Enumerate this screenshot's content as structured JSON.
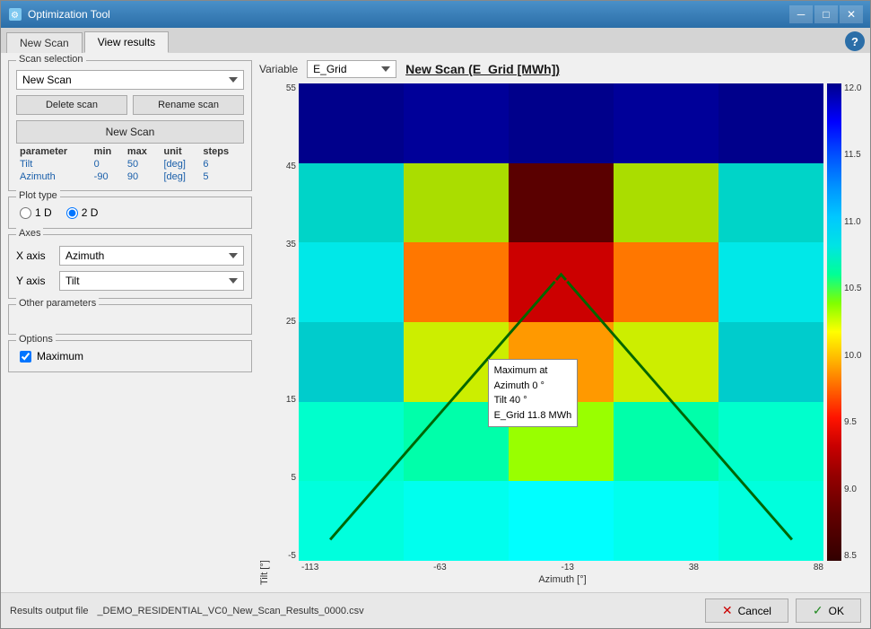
{
  "window": {
    "title": "Optimization Tool",
    "tabs": [
      "New Scan",
      "View results"
    ],
    "active_tab": "View results",
    "help_label": "?"
  },
  "left": {
    "scan_selection_label": "Scan selection",
    "scan_dropdown_value": "New Scan",
    "scan_dropdown_options": [
      "New Scan"
    ],
    "delete_scan_label": "Delete scan",
    "rename_scan_label": "Rename scan",
    "new_scan_label": "New Scan",
    "params_headers": [
      "parameter",
      "min",
      "max",
      "unit",
      "steps"
    ],
    "params_rows": [
      [
        "Tilt",
        "0",
        "50",
        "[deg]",
        "6"
      ],
      [
        "Azimuth",
        "-90",
        "90",
        "[deg]",
        "5"
      ]
    ],
    "plot_type_label": "Plot type",
    "radio_1d": "1 D",
    "radio_2d": "2 D",
    "active_radio": "2D",
    "axes_label": "Axes",
    "x_axis_label": "X axis",
    "x_axis_value": "Azimuth",
    "x_axis_options": [
      "Azimuth",
      "Tilt"
    ],
    "y_axis_label": "Y axis",
    "y_axis_value": "Tilt",
    "y_axis_options": [
      "Tilt",
      "Azimuth"
    ],
    "other_params_label": "Other parameters",
    "options_label": "Options",
    "maximum_checkbox_label": "Maximum",
    "maximum_checked": true
  },
  "right": {
    "variable_label": "Variable",
    "variable_value": "E_Grid",
    "variable_options": [
      "E_Grid"
    ],
    "chart_title": "New Scan (E_Grid [MWh])",
    "x_axis_ticks": [
      "-113",
      "-63",
      "-13",
      "38",
      "88"
    ],
    "y_axis_ticks": [
      "55",
      "45",
      "35",
      "25",
      "15",
      "5",
      "-5"
    ],
    "x_axis_title": "Azimuth [°]",
    "y_axis_title": "Tilt [°]",
    "colorbar_max": "12.0",
    "colorbar_11_5": "11.5",
    "colorbar_11": "11.0",
    "colorbar_10_5": "10.5",
    "colorbar_10": "10.0",
    "colorbar_9_5": "9.5",
    "colorbar_9": "9.0",
    "colorbar_8_5": "8.5",
    "tooltip_line1": "Maximum at",
    "tooltip_line2": "Azimuth 0 °",
    "tooltip_line3": "Tilt 40 °",
    "tooltip_line4": "E_Grid 11.8 MWh"
  },
  "footer": {
    "output_label": "Results output file",
    "output_value": "_DEMO_RESIDENTIAL_VC0_New_Scan_Results_0000.csv",
    "cancel_label": "Cancel",
    "ok_label": "OK"
  }
}
